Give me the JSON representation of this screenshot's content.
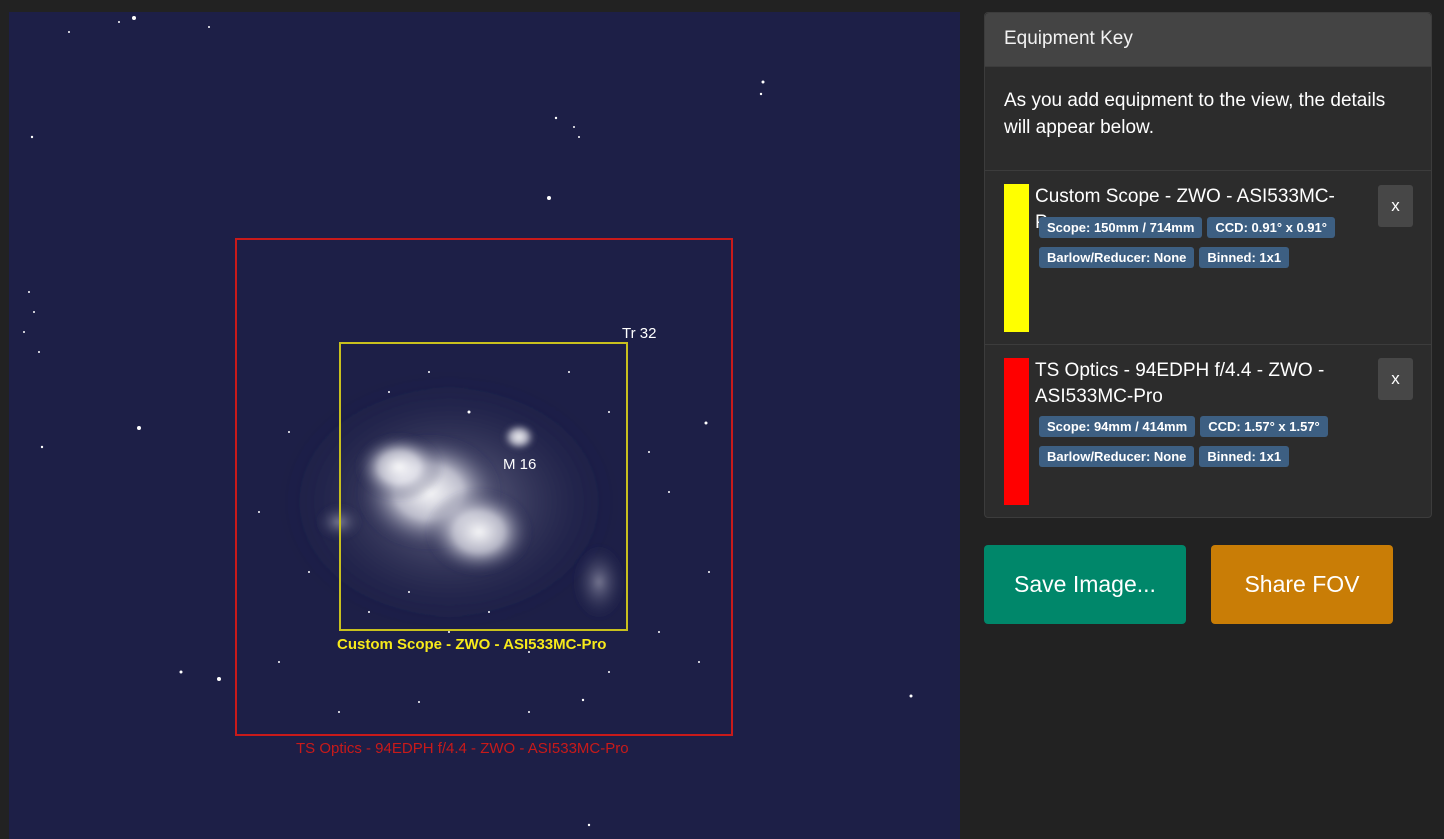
{
  "sky": {
    "objects": [
      {
        "name": "M 16"
      },
      {
        "name": "Tr 32"
      }
    ],
    "fov_labels": [
      {
        "text": "Custom Scope - ZWO - ASI533MC-Pro",
        "color": "#f7ea1a"
      },
      {
        "text": "TS Optics - 94EDPH f/4.4 - ZWO - ASI533MC-Pro",
        "color": "#c81a1a"
      }
    ]
  },
  "equipment_key": {
    "title": "Equipment Key",
    "intro": "As you add equipment to the view, the details will appear below.",
    "items": [
      {
        "title": "Custom Scope - ZWO - ASI533MC-Pro",
        "color": "#ffff00",
        "badges": [
          "Scope: 150mm / 714mm",
          "CCD: 0.91° x 0.91°",
          "Barlow/Reducer: None",
          "Binned: 1x1"
        ],
        "remove_label": "x"
      },
      {
        "title": "TS Optics - 94EDPH f/4.4 - ZWO - ASI533MC-Pro",
        "color": "#ff0000",
        "badges": [
          "Scope: 94mm / 414mm",
          "CCD: 1.57° x 1.57°",
          "Barlow/Reducer: None",
          "Binned: 1x1"
        ],
        "remove_label": "x"
      }
    ]
  },
  "actions": {
    "save_label": "Save Image...",
    "save_color": "#00876a",
    "share_label": "Share FOV",
    "share_color": "#c97d06"
  }
}
